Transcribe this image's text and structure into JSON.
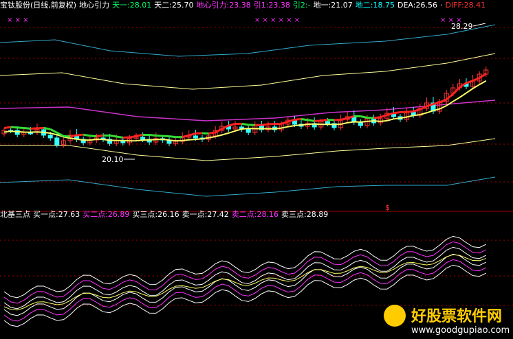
{
  "main_panel": {
    "indicator_row": [
      {
        "text": "宝钛股份(日线,前复权)",
        "color": "#ffffff"
      },
      {
        "text": "地心引力",
        "color": "#ffffff"
      },
      {
        "text": "天一:28.01",
        "color": "#00ff66"
      },
      {
        "text": "天二:25.70",
        "color": "#ffffff"
      },
      {
        "text": "地心引力:23.38",
        "color": "#ff33ff"
      },
      {
        "text": "引1:23.38",
        "color": "#ff33ff"
      },
      {
        "text": "引2:-",
        "color": "#00ff66"
      },
      {
        "text": "地一:21.07",
        "color": "#ffffff"
      },
      {
        "text": "地二:18.75",
        "color": "#00ffff"
      },
      {
        "text": "DEA:26.56",
        "color": "#ffffff"
      },
      {
        "text": "·",
        "color": "#ffffff"
      },
      {
        "text": "DIFF:28.41",
        "color": "#ff3333"
      }
    ],
    "high_label": "28.29",
    "low_label": "20.10",
    "marker_label": "$",
    "x_marks": "× × ×"
  },
  "sub_panel": {
    "indicator_row": [
      {
        "text": "北基三点",
        "color": "#ffffff"
      },
      {
        "text": "买一点:27.63",
        "color": "#ffffff"
      },
      {
        "text": "买二点:26.89",
        "color": "#ff33ff"
      },
      {
        "text": "买三点:26.16",
        "color": "#ffffff"
      },
      {
        "text": "卖一点:27.42",
        "color": "#ffffff"
      },
      {
        "text": "卖二点:28.16",
        "color": "#ff33ff"
      },
      {
        "text": "卖三点:28.89",
        "color": "#ffffff"
      }
    ]
  },
  "watermark": {
    "title": "好股票软件网",
    "url": "www.goodgupiao.com"
  },
  "colors": {
    "up": "#ff3333",
    "down": "#33ffff",
    "ma_yellow": "#ffff66",
    "purple": "#cc33cc",
    "cyan": "#33aacc",
    "grid": "#aa0000"
  }
}
